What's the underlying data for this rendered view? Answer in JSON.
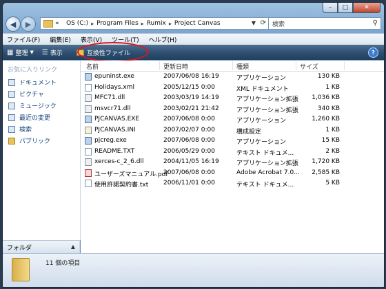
{
  "window": {
    "close_glyph": "✕",
    "min_glyph": "–",
    "max_glyph": "□"
  },
  "address": {
    "overflow": "«",
    "crumbs": [
      "OS (C:)",
      "Program Files",
      "Rumix",
      "Project Canvas"
    ],
    "sep": "▸",
    "search_placeholder": "検索"
  },
  "menu": [
    "ファイル(F)",
    "編集(E)",
    "表示(V)",
    "ツール(T)",
    "ヘルプ(H)"
  ],
  "commands": {
    "organize": "整理",
    "views": "表示",
    "compat": "互換性ファイル"
  },
  "sidebar": {
    "heading": "お気に入りリンク",
    "items": [
      "ドキュメント",
      "ピクチャ",
      "ミュージック",
      "最近の変更",
      "検索",
      "パブリック"
    ],
    "folders_label": "フォルダ"
  },
  "columns": {
    "name": "名前",
    "date": "更新日時",
    "type": "種類",
    "size": "サイズ"
  },
  "files": [
    {
      "name": "epuninst.exe",
      "date": "2007/06/08 16:19",
      "type": "アプリケーション",
      "size": "130 KB",
      "icon": "exe-icon"
    },
    {
      "name": "Holidays.xml",
      "date": "2005/12/15 0:00",
      "type": "XML ドキュメント",
      "size": "1 KB",
      "icon": "xml-icon"
    },
    {
      "name": "MFC71.dll",
      "date": "2003/03/19 14:19",
      "type": "アプリケーション拡張",
      "size": "1,036 KB",
      "icon": "dll-icon"
    },
    {
      "name": "msvcr71.dll",
      "date": "2003/02/21 21:42",
      "type": "アプリケーション拡張",
      "size": "340 KB",
      "icon": "dll-icon"
    },
    {
      "name": "PJCANVAS.EXE",
      "date": "2007/06/08 0:00",
      "type": "アプリケーション",
      "size": "1,260 KB",
      "icon": "exe-icon"
    },
    {
      "name": "PJCANVAS.INI",
      "date": "2007/02/07 0:00",
      "type": "構成設定",
      "size": "1 KB",
      "icon": "ini-icon"
    },
    {
      "name": "pjcreg.exe",
      "date": "2007/06/08 0:00",
      "type": "アプリケーション",
      "size": "15 KB",
      "icon": "exe-icon"
    },
    {
      "name": "README.TXT",
      "date": "2006/05/29 0:00",
      "type": "テキスト ドキュメ...",
      "size": "2 KB",
      "icon": "txt-icon"
    },
    {
      "name": "xerces-c_2_6.dll",
      "date": "2004/11/05 16:19",
      "type": "アプリケーション拡張",
      "size": "1,720 KB",
      "icon": "dll-icon"
    },
    {
      "name": "ユーザーズマニュアル.pdf",
      "date": "2007/06/08 0:00",
      "type": "Adobe Acrobat 7.0...",
      "size": "2,585 KB",
      "icon": "pdf-icon"
    },
    {
      "name": "使用許諾契約書.txt",
      "date": "2006/11/01 0:00",
      "type": "テキスト ドキュメ...",
      "size": "5 KB",
      "icon": "txt-icon"
    }
  ],
  "details": {
    "count": "11 個の項目"
  },
  "colors": {
    "highlight_oval": "#e4141c",
    "command_bar": "#2d4e70"
  }
}
